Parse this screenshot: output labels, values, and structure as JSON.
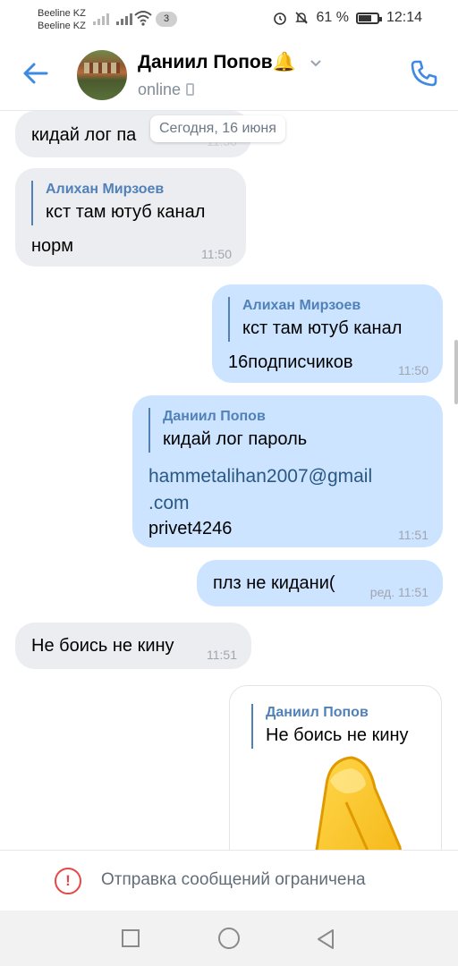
{
  "status_bar": {
    "carrier1": "Beeline KZ",
    "carrier2": "Beeline KZ",
    "notification_count": "3",
    "battery": "61 %",
    "time": "12:14"
  },
  "header": {
    "name": "Даниил Попов",
    "status": "online",
    "bell_emoji": "🔔"
  },
  "date_separator": "Сегодня, 16 июня",
  "messages": [
    {
      "side": "in",
      "text": "кидай лог па",
      "time": "11:50"
    },
    {
      "side": "in",
      "reply_author": "Алихан Мирзоев",
      "reply_text": "кст там ютуб канал",
      "text": "норм",
      "time": "11:50"
    },
    {
      "side": "out",
      "reply_author": "Алихан Мирзоев",
      "reply_text": "кст там ютуб канал",
      "text": "16подписчиков",
      "time": "11:50"
    },
    {
      "side": "out",
      "reply_author": "Даниил Попов",
      "reply_text": "кидай лог пароль",
      "link_line1": "hammetalihan2007@gmail",
      "link_line2": ".com",
      "text": "privet4246",
      "time": "11:51"
    },
    {
      "side": "out",
      "text": "плз не кидани(",
      "time": "ред. 11:51"
    },
    {
      "side": "in",
      "text": "Не боись не кину",
      "time": "11:51"
    },
    {
      "side": "out",
      "reply_author": "Даниил Попов",
      "reply_text": "Не боись не кину",
      "sticker": "ok-hand-sticker"
    }
  ],
  "restricted": {
    "icon": "!",
    "text": "Отправка сообщений ограничена"
  },
  "colors": {
    "accent": "#2a5885",
    "icon_blue": "#3f8ae0",
    "incoming_bubble": "#ebedf0",
    "outgoing_bubble": "#cce4ff",
    "warning": "#e64646"
  }
}
